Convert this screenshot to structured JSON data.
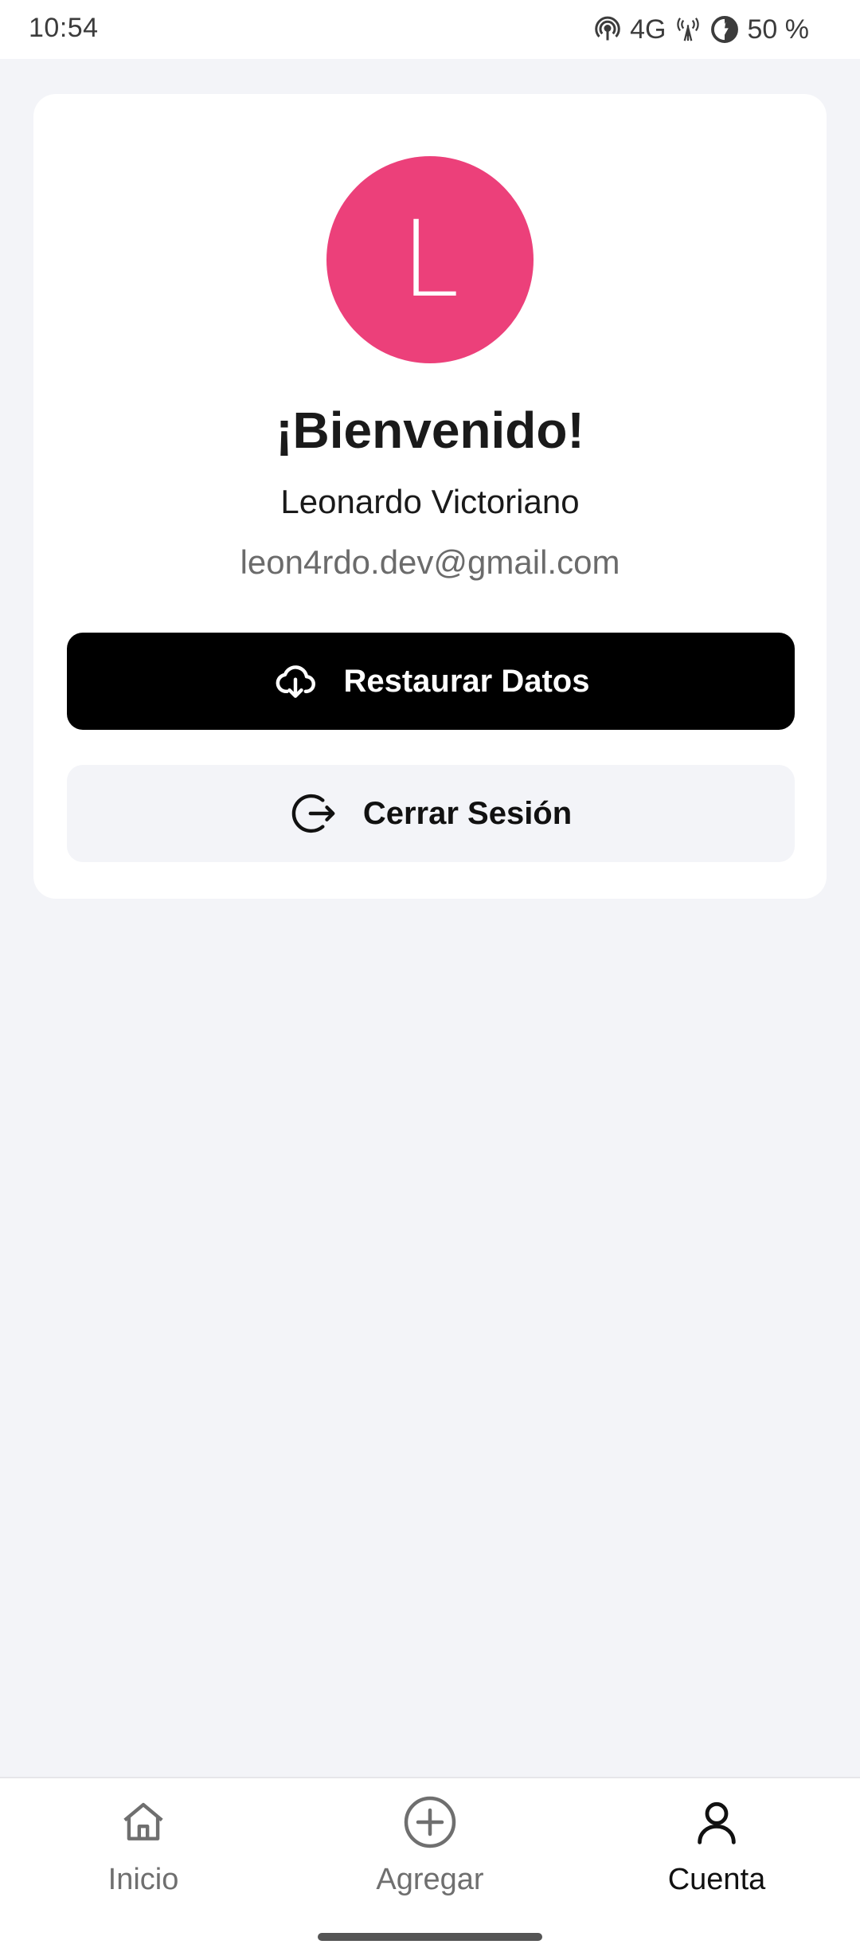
{
  "status_bar": {
    "time": "10:54",
    "network": "4G",
    "battery": "50 %",
    "icons": [
      "hotspot-icon",
      "signal-tower-icon",
      "battery-saver-icon"
    ]
  },
  "profile": {
    "avatar_letter": "L",
    "avatar_color": "#ec407a",
    "welcome": "¡Bienvenido!",
    "name": "Leonardo Victoriano",
    "email": "leon4rdo.dev@gmail.com"
  },
  "actions": {
    "restore_label": "Restaurar Datos",
    "restore_icon": "cloud-download-icon",
    "logout_label": "Cerrar Sesión",
    "logout_icon": "logout-icon"
  },
  "bottom_nav": {
    "items": [
      {
        "label": "Inicio",
        "icon": "home-icon",
        "active": false
      },
      {
        "label": "Agregar",
        "icon": "add-circle-icon",
        "active": false
      },
      {
        "label": "Cuenta",
        "icon": "person-icon",
        "active": true
      }
    ]
  },
  "colors": {
    "background": "#f3f4f8",
    "card": "#ffffff",
    "primary_button": "#000000",
    "secondary_button": "#f3f4f8"
  }
}
